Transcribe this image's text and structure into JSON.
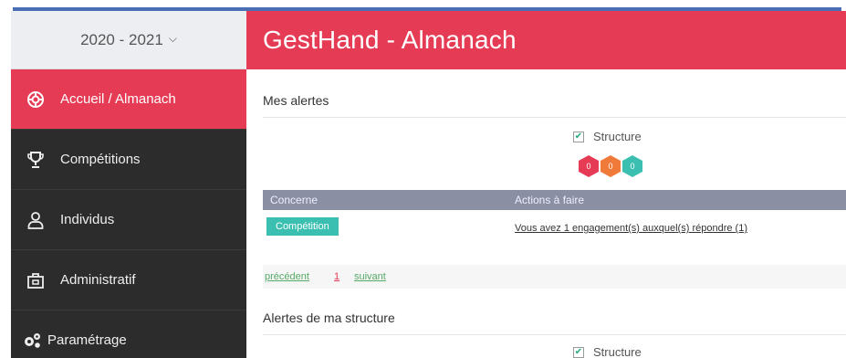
{
  "season": {
    "label": "2020 - 2021",
    "chevron": "chevron-down-icon"
  },
  "sidebar": {
    "items": [
      {
        "label": "Accueil / Almanach",
        "icon": "life-ring-icon",
        "active": true
      },
      {
        "label": "Compétitions",
        "icon": "trophy-icon",
        "active": false
      },
      {
        "label": "Individus",
        "icon": "user-icon",
        "active": false
      },
      {
        "label": "Administratif",
        "icon": "briefcase-icon",
        "active": false
      },
      {
        "label": "Paramétrage",
        "icon": "gears-icon",
        "active": false
      }
    ]
  },
  "header": {
    "title": "GestHand - Almanach"
  },
  "alerts": {
    "title": "Mes alertes",
    "filter": {
      "label": "Structure",
      "checked": true
    },
    "hexes": [
      {
        "value": "0",
        "color": "#e63b54"
      },
      {
        "value": "0",
        "color": "#f07a3a"
      },
      {
        "value": "0",
        "color": "#3bbfb0"
      }
    ],
    "table": {
      "headers": [
        "Concerne",
        "Actions à faire"
      ],
      "rows": [
        {
          "concerne": "Compétition",
          "action": "Vous avez 1 engagement(s) auxquel(s) répondre (1)"
        }
      ]
    },
    "pager": {
      "prev": "précédent",
      "page": "1",
      "next": "suivant"
    }
  },
  "structure_alerts": {
    "title": "Alertes de ma structure",
    "filter": {
      "label": "Structure",
      "checked": true
    }
  },
  "colors": {
    "accent": "#e63b54",
    "sidebar": "#2c2c2c",
    "teal": "#3bbfb0",
    "table_header": "#8a8fa3"
  }
}
